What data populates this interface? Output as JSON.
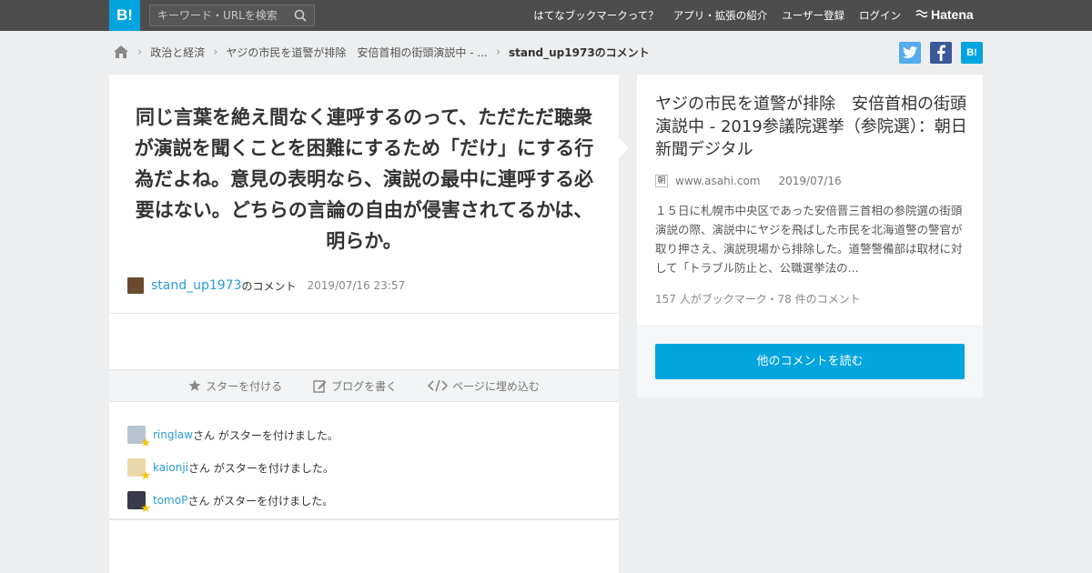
{
  "header": {
    "logo": "B!",
    "search_placeholder": "キーワード・URLを検索",
    "nav": [
      "はてなブックマークって？",
      "アプリ・拡張の紹介",
      "ユーザー登録",
      "ログイン"
    ],
    "brand": "Hatena"
  },
  "breadcrumb": {
    "items": [
      "政治と経済",
      "ヤジの市民を道警が排除　安倍首相の街頭演説中 - ..."
    ],
    "current": "stand_up1973のコメント"
  },
  "share": {
    "twitter": "t",
    "facebook": "f",
    "hatena": "B!"
  },
  "comment": {
    "text": "同じ言葉を絶え間なく連呼するのって、ただただ聴衆が演説を聞くことを困難にするため「だけ」にする行為だよね。意見の表明なら、演説の最中に連呼する必要はない。どちらの言論の自由が侵害されてるかは、明らか。",
    "user": "stand_up1973",
    "suffix": "のコメント",
    "date": "2019/07/16 23:57"
  },
  "actions": {
    "star": "スターを付ける",
    "blog": "ブログを書く",
    "embed": "ページに埋め込む"
  },
  "stars": [
    {
      "user": "ringlaw",
      "text": "さん がスターを付けました。"
    },
    {
      "user": "kaionji",
      "text": "さん がスターを付けました。"
    },
    {
      "user": "tomoP",
      "text": "さん がスターを付けました。"
    }
  ],
  "article": {
    "title": "ヤジの市民を道警が排除　安倍首相の街頭演説中 - 2019参議院選挙（参院選）：朝日新聞デジタル",
    "favicon": "朝",
    "site": "www.asahi.com",
    "date": "2019/07/16",
    "excerpt": "１５日に札幌市中央区であった安倍晋三首相の参院選の街頭演説の際、演説中にヤジを飛ばした市民を北海道警の警官が取り押さえ、演説現場から排除した。道警警備部は取材に対して「トラブル防止と、公職選挙法の...",
    "stats": "157 人がブックマーク・78 件のコメント"
  },
  "read_more": "他のコメントを読む",
  "colors": {
    "accent": "#00a4de",
    "link": "#2a9bd6",
    "topbar": "#4d4d4d"
  }
}
